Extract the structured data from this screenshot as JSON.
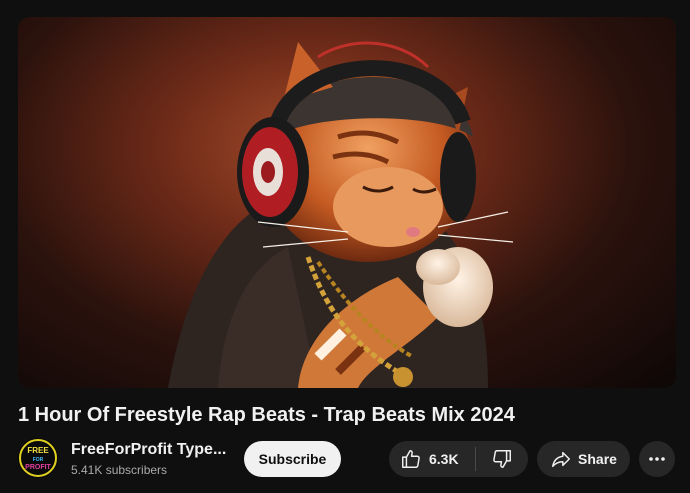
{
  "video": {
    "thumbnail_icon": "cat-headphones-artwork"
  },
  "title": "1 Hour Of Freestyle Rap Beats - Trap Beats Mix 2024",
  "channel": {
    "name": "FreeForProfit Type...",
    "subscribers": "5.41K subscribers",
    "avatar_text_top": "FREE",
    "avatar_text_mid": "FOR",
    "avatar_text_bottom": "PROFIT"
  },
  "actions": {
    "subscribe_label": "Subscribe",
    "like_count": "6.3K",
    "share_label": "Share",
    "like_icon": "thumbs-up-icon",
    "dislike_icon": "thumbs-down-icon",
    "share_icon": "share-arrow-icon",
    "more_icon": "more-horizontal-icon"
  },
  "colors": {
    "background": "#0f0f0f",
    "button_bg": "#272727",
    "subscribe_bg": "#f1f1f1",
    "text_primary": "#f1f1f1",
    "text_secondary": "#aaaaaa"
  }
}
